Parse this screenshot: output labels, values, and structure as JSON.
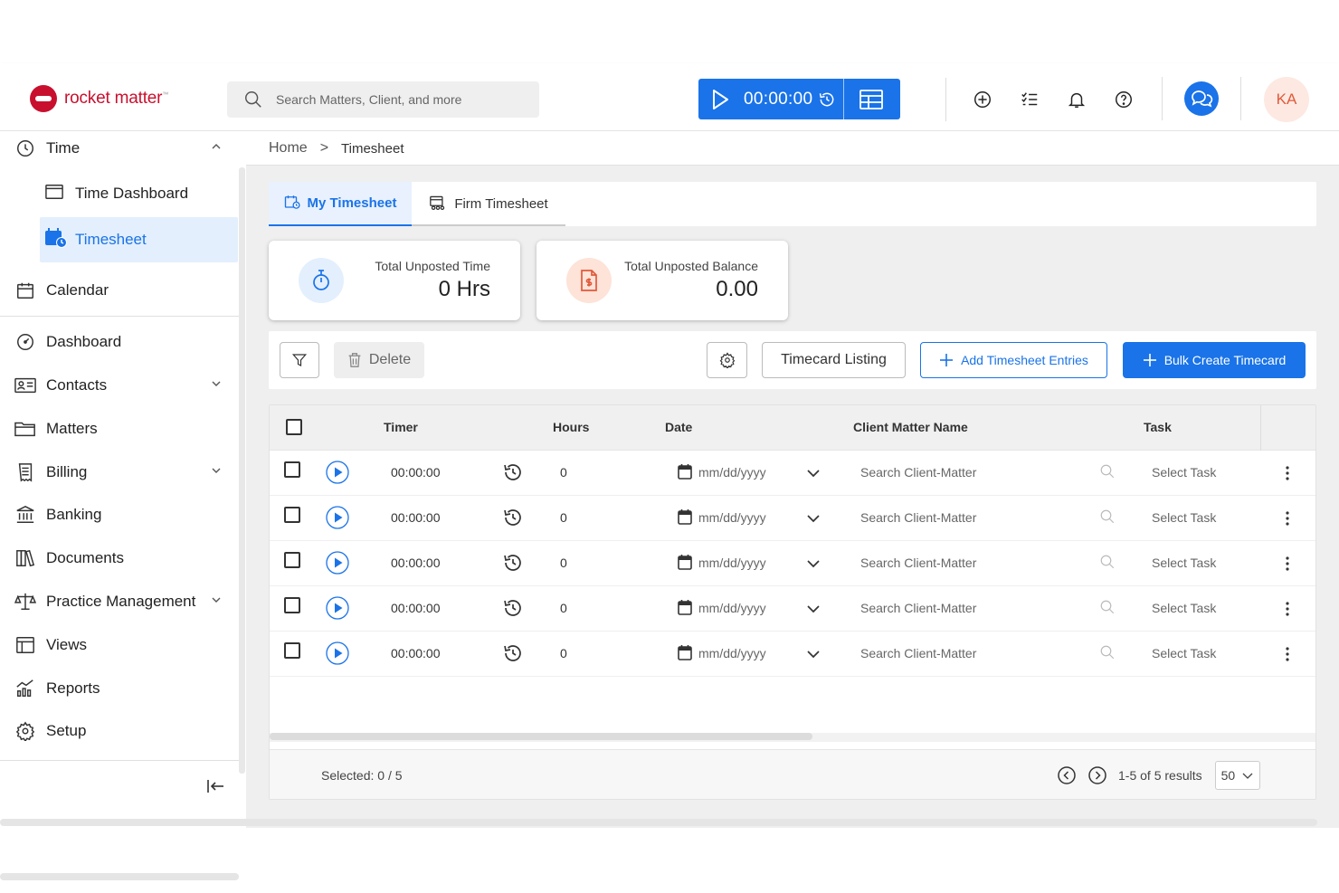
{
  "header": {
    "logo_text": "rocket matter",
    "logo_tm": "™",
    "search_placeholder": "Search Matters, Client, and more",
    "timer_value": "00:00:00",
    "avatar_initials": "KA"
  },
  "sidebar": {
    "time": "Time",
    "time_dashboard": "Time Dashboard",
    "timesheet": "Timesheet",
    "calendar": "Calendar",
    "dashboard": "Dashboard",
    "contacts": "Contacts",
    "matters": "Matters",
    "billing": "Billing",
    "banking": "Banking",
    "documents": "Documents",
    "practice_management": "Practice Management",
    "views": "Views",
    "reports": "Reports",
    "setup": "Setup"
  },
  "breadcrumb": {
    "home": "Home",
    "separator": ">",
    "current": "Timesheet"
  },
  "tabs": {
    "my_timesheet": "My Timesheet",
    "firm_timesheet": "Firm Timesheet"
  },
  "cards": {
    "time_title": "Total Unposted Time",
    "time_value": "0 Hrs",
    "balance_title": "Total Unposted Balance",
    "balance_value": "0.00"
  },
  "toolbar": {
    "delete": "Delete",
    "timecard_listing": "Timecard Listing",
    "add_entries": "Add Timesheet Entries",
    "bulk_create": "Bulk Create Timecard"
  },
  "table": {
    "headers": {
      "timer": "Timer",
      "hours": "Hours",
      "date": "Date",
      "client_matter": "Client Matter Name",
      "task": "Task"
    },
    "rows": [
      {
        "timer": "00:00:00",
        "hours": "0",
        "date": "mm/dd/yyyy",
        "client_matter": "Search Client-Matter",
        "task": "Select Task"
      },
      {
        "timer": "00:00:00",
        "hours": "0",
        "date": "mm/dd/yyyy",
        "client_matter": "Search Client-Matter",
        "task": "Select Task"
      },
      {
        "timer": "00:00:00",
        "hours": "0",
        "date": "mm/dd/yyyy",
        "client_matter": "Search Client-Matter",
        "task": "Select Task"
      },
      {
        "timer": "00:00:00",
        "hours": "0",
        "date": "mm/dd/yyyy",
        "client_matter": "Search Client-Matter",
        "task": "Select Task"
      },
      {
        "timer": "00:00:00",
        "hours": "0",
        "date": "mm/dd/yyyy",
        "client_matter": "Search Client-Matter",
        "task": "Select Task"
      }
    ]
  },
  "footer": {
    "selected": "Selected: 0 / 5",
    "results": "1-5 of 5 results",
    "page_size": "50"
  },
  "colors": {
    "accent": "#1a73e8",
    "brand": "#c8102e",
    "balance_icon": "#e05a3a"
  }
}
